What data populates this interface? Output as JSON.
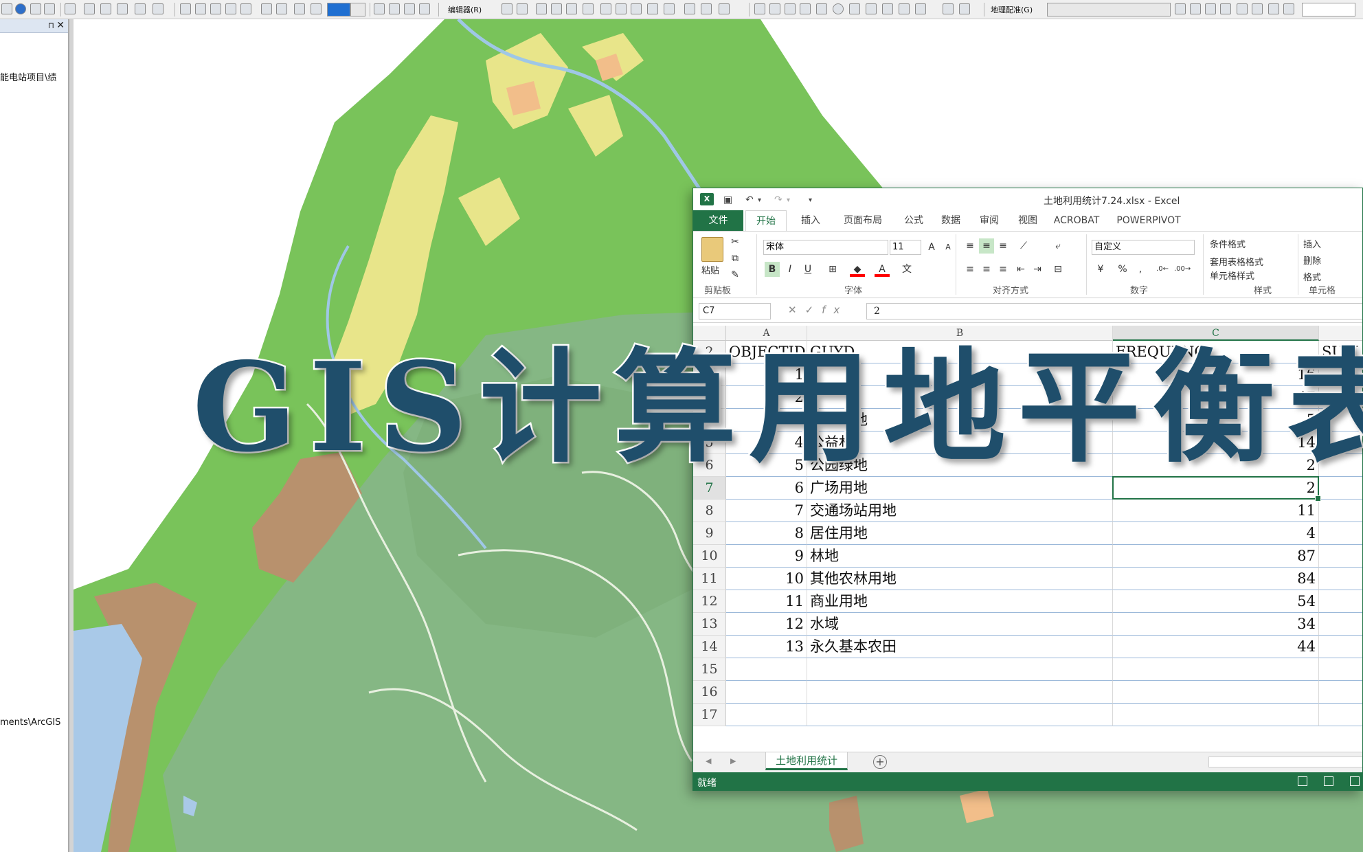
{
  "overlay_title": "GIS计算用地平衡表",
  "arcmap": {
    "toolbar": {
      "editor_menu": "编辑器(R)",
      "georef_menu": "地理配准(G)"
    },
    "toc": {
      "path_top": "能电站项目\\绩",
      "path_bottom": "ments\\ArcGIS"
    }
  },
  "excel": {
    "title": "土地利用统计7.24.xlsx - Excel",
    "logo": "X",
    "tabs": [
      "文件",
      "开始",
      "插入",
      "页面布局",
      "公式",
      "数据",
      "审阅",
      "视图",
      "ACROBAT",
      "POWERPIVOT"
    ],
    "ribbon": {
      "paste_label": "粘贴",
      "font_name": "宋体",
      "font_size": "11",
      "number_format": "自定义",
      "bold": "B",
      "italic": "I",
      "underline": "U",
      "percent": "%",
      "comma": ",",
      "fill_color": "#ff0000",
      "font_color": "#ff0000",
      "styles": [
        "条件格式",
        "套用表格格式",
        "单元格样式"
      ],
      "cells": [
        "插入",
        "删除",
        "格式"
      ],
      "group_labels": [
        "剪贴板",
        "字体",
        "对齐方式",
        "数字",
        "样式",
        "单元格"
      ]
    },
    "formula_bar": {
      "name_box": "C7",
      "fx": "fx",
      "value": "2"
    },
    "columns": [
      {
        "letter": "A",
        "selected": false
      },
      {
        "letter": "B",
        "selected": false
      },
      {
        "letter": "C",
        "selected": true
      },
      {
        "letter": "",
        "selected": false
      }
    ],
    "header_row": {
      "num": "2",
      "a": "OBJECTID",
      "b": "GUYD",
      "c": "FREQUENCY",
      "d": "SUM_S"
    },
    "rows": [
      {
        "num": "3",
        "id": "1",
        "name": "",
        "freq": "16"
      },
      {
        "num": "4",
        "id": "2",
        "name": "",
        "freq": "47"
      },
      {
        "num": "5",
        "id": "3",
        "name": "工业用地",
        "freq": "5"
      },
      {
        "num": "5",
        "id": "4",
        "name": "公益林",
        "freq": "14"
      },
      {
        "num": "6",
        "id": "5",
        "name": "公园绿地",
        "freq": "2"
      },
      {
        "num": "7",
        "id": "6",
        "name": "广场用地",
        "freq": "2"
      },
      {
        "num": "8",
        "id": "7",
        "name": "交通场站用地",
        "freq": "11"
      },
      {
        "num": "9",
        "id": "8",
        "name": "居住用地",
        "freq": "4"
      },
      {
        "num": "10",
        "id": "9",
        "name": "林地",
        "freq": "87"
      },
      {
        "num": "11",
        "id": "10",
        "name": "其他农林用地",
        "freq": "84"
      },
      {
        "num": "12",
        "id": "11",
        "name": "商业用地",
        "freq": "54"
      },
      {
        "num": "13",
        "id": "12",
        "name": "水域",
        "freq": "34"
      },
      {
        "num": "14",
        "id": "13",
        "name": "永久基本农田",
        "freq": "44"
      },
      {
        "num": "15",
        "id": "",
        "name": "",
        "freq": ""
      },
      {
        "num": "16",
        "id": "",
        "name": "",
        "freq": ""
      },
      {
        "num": "17",
        "id": "",
        "name": "",
        "freq": ""
      }
    ],
    "sheet_tab": "土地利用统计",
    "add_sheet": "+",
    "status": "就绪",
    "accent_color": "#217346"
  },
  "map_colors": {
    "forest_light": "#79c35a",
    "forest_dark": "#85b784",
    "farmland_yellow": "#e8e58a",
    "residential_brown": "#b8916d",
    "water_blue": "#a9c9e8",
    "river": "#9fc7e6",
    "orange_patch": "#f2be8a"
  }
}
